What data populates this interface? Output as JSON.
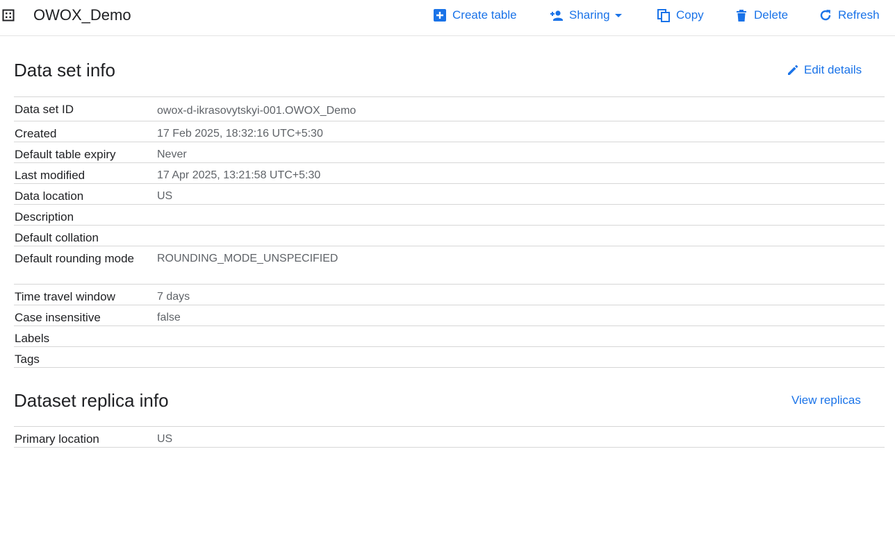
{
  "header": {
    "title": "OWOX_Demo",
    "actions": [
      {
        "label": "Create table",
        "icon": "add-box-icon"
      },
      {
        "label": "Sharing",
        "icon": "person-add-icon"
      },
      {
        "label": "Copy",
        "icon": "copy-icon"
      },
      {
        "label": "Delete",
        "icon": "trash-icon"
      },
      {
        "label": "Refresh",
        "icon": "refresh-icon"
      }
    ]
  },
  "dataset_info": {
    "title": "Data set info",
    "edit_label": "Edit details",
    "rows": [
      {
        "key": "Data set ID",
        "value": "owox-d-ikrasovytskyi-001.OWOX_Demo"
      },
      {
        "key": "Created",
        "value": "17 Feb 2025, 18:32:16 UTC+5:30"
      },
      {
        "key": "Default table expiry",
        "value": "Never"
      },
      {
        "key": "Last modified",
        "value": "17 Apr 2025, 13:21:58 UTC+5:30"
      },
      {
        "key": "Data location",
        "value": "US"
      },
      {
        "key": "Description",
        "value": ""
      },
      {
        "key": "Default collation",
        "value": ""
      },
      {
        "key": "Default rounding mode",
        "value": "ROUNDING_MODE_UNSPECIFIED"
      },
      {
        "key": "Time travel window",
        "value": "7 days"
      },
      {
        "key": "Case insensitive",
        "value": "false"
      },
      {
        "key": "Labels",
        "value": ""
      },
      {
        "key": "Tags",
        "value": ""
      }
    ]
  },
  "replica_info": {
    "title": "Dataset replica info",
    "view_label": "View replicas",
    "rows": [
      {
        "key": "Primary location",
        "value": "US"
      }
    ]
  },
  "colors": {
    "accent": "#1a73e8",
    "text": "#202124",
    "muted": "#5f6368",
    "divider": "#d6d6d6"
  }
}
